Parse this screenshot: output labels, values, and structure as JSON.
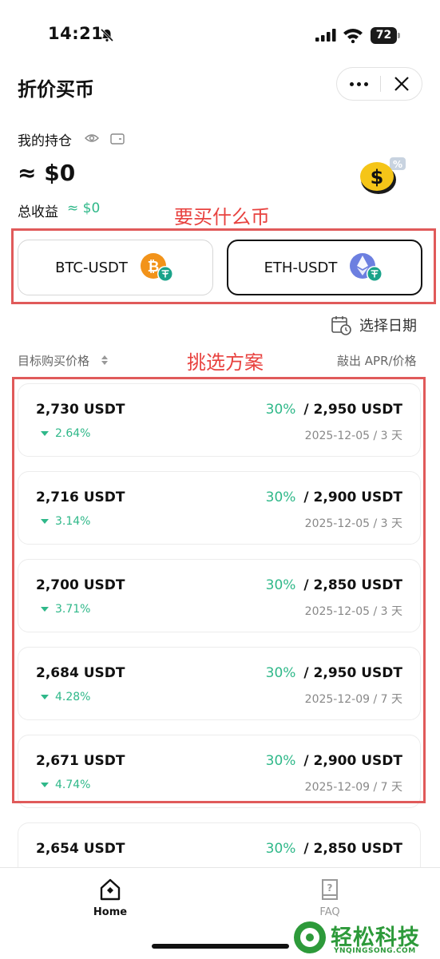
{
  "status_bar": {
    "time": "14:21",
    "battery": "72"
  },
  "header": {
    "title": "折价买币"
  },
  "holdings": {
    "label": "我的持仓",
    "value": "≈ $0",
    "earnings_label": "总收益",
    "earnings_value": "≈ $0"
  },
  "annotations": {
    "pick_coin": "要买什么币",
    "pick_plan": "挑选方案"
  },
  "pairs": [
    {
      "label": "BTC-USDT",
      "selected": false
    },
    {
      "label": "ETH-USDT",
      "selected": true
    }
  ],
  "date_picker": {
    "label": "选择日期"
  },
  "list_header": {
    "left": "目标购买价格",
    "right": "敲出 APR/价格"
  },
  "plans": [
    {
      "target_price": "2,730 USDT",
      "discount": "2.64%",
      "apr": "30%",
      "knockout": "/ 2,950 USDT",
      "settle": "2025-12-05 / 3 天"
    },
    {
      "target_price": "2,716 USDT",
      "discount": "3.14%",
      "apr": "30%",
      "knockout": "/ 2,900 USDT",
      "settle": "2025-12-05 / 3 天"
    },
    {
      "target_price": "2,700 USDT",
      "discount": "3.71%",
      "apr": "30%",
      "knockout": "/ 2,850 USDT",
      "settle": "2025-12-05 / 3 天"
    },
    {
      "target_price": "2,684 USDT",
      "discount": "4.28%",
      "apr": "30%",
      "knockout": "/ 2,950 USDT",
      "settle": "2025-12-09 / 7 天"
    },
    {
      "target_price": "2,671 USDT",
      "discount": "4.74%",
      "apr": "30%",
      "knockout": "/ 2,900 USDT",
      "settle": "2025-12-09 / 7 天"
    },
    {
      "target_price": "2,654 USDT",
      "discount": "",
      "apr": "30%",
      "knockout": "/ 2,850 USDT",
      "settle": ""
    }
  ],
  "nav": {
    "home": "Home",
    "faq": "FAQ"
  },
  "watermark": {
    "text": "轻松科技",
    "sub": "YNQINGSONG.COM"
  },
  "colors": {
    "accent_green": "#2fb889",
    "annotation_red": "#e8423f",
    "btc_orange": "#f2931a",
    "eth_purple": "#6c7fe0",
    "usdt_teal": "#1aa38a"
  }
}
